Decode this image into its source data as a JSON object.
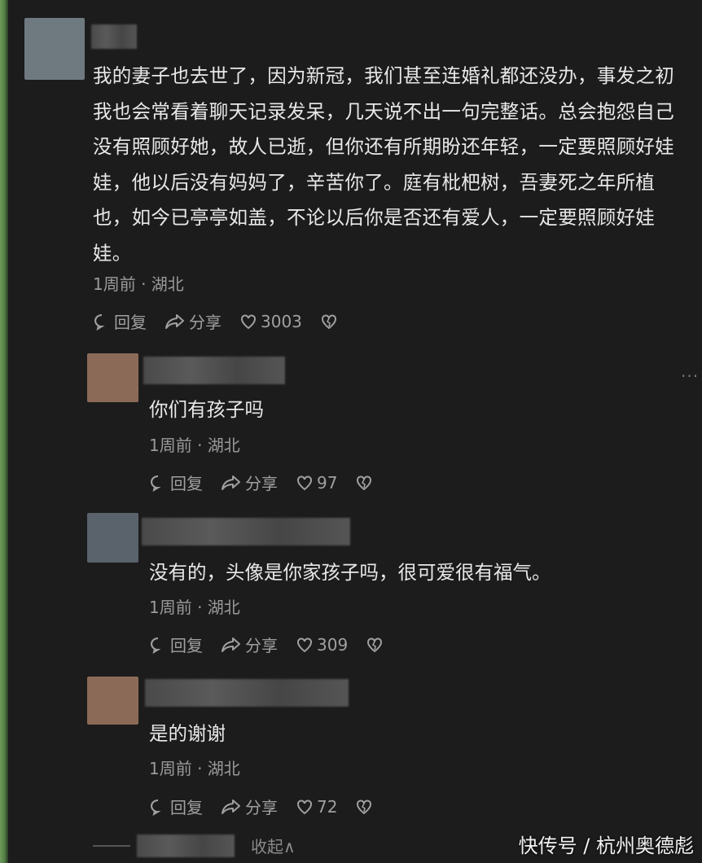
{
  "top_cut_text": "———",
  "comment": {
    "avatar_color": "#6f7a80",
    "text": "我的妻子也去世了，因为新冠，我们甚至连婚礼都还没办，事发之初我也会常看着聊天记录发呆，几天说不出一句完整话。总会抱怨自己没有照顾好她，故人已逝，但你还有所期盼还年轻，一定要照顾好娃娃，他以后没有妈妈了，辛苦你了。庭有枇杷树，吾妻死之年所植也，如今已亭亭如盖，不论以后你是否还有爱人，一定要照顾好娃娃。",
    "meta": "1周前 · 湖北",
    "reply_label": "回复",
    "share_label": "分享",
    "likes": "3003"
  },
  "replies": [
    {
      "avatar_color": "#8c6a58",
      "text": "你们有孩子吗",
      "meta": "1周前 · 湖北",
      "reply_label": "回复",
      "share_label": "分享",
      "likes": "97"
    },
    {
      "avatar_color": "#5a626c",
      "text": "没有的，头像是你家孩子吗，很可爱很有福气。",
      "meta": "1周前 · 湖北",
      "reply_label": "回复",
      "share_label": "分享",
      "likes": "309"
    },
    {
      "avatar_color": "#8c6a58",
      "text": "是的谢谢",
      "meta": "1周前 · 湖北",
      "reply_label": "回复",
      "share_label": "分享",
      "likes": "72"
    }
  ],
  "more_dots": "···",
  "collapse_label": "收起∧",
  "watermark": "快传号 / 杭州奥德彪"
}
